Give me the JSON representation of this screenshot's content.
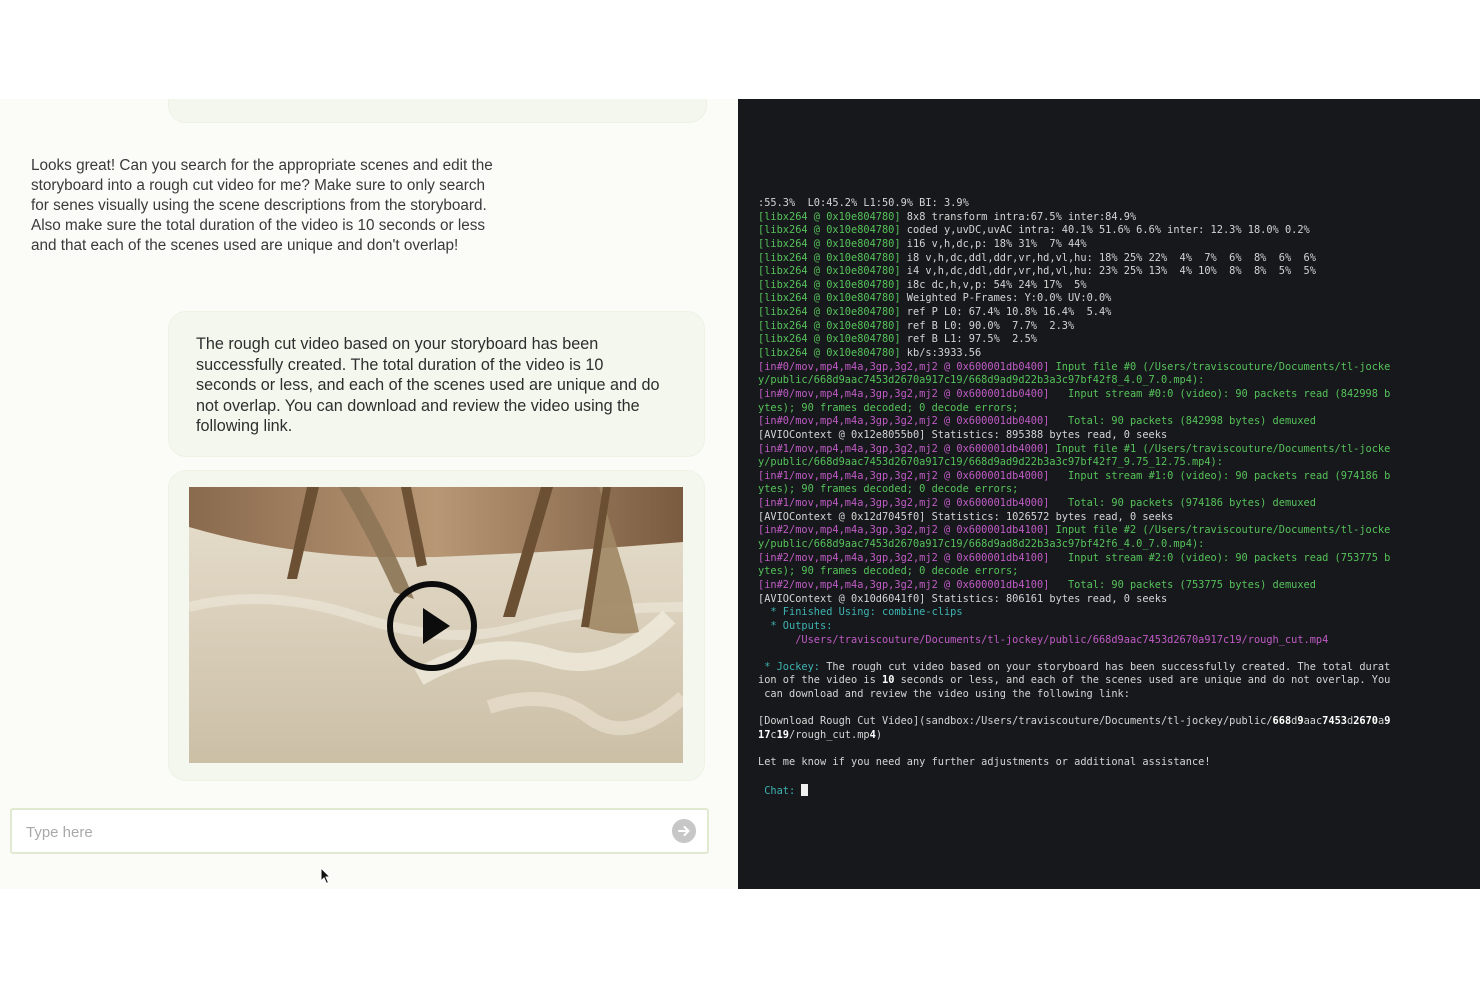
{
  "chat": {
    "user_message": "Looks great! Can you search for the appropriate scenes and edit the storyboard into a rough cut video for me? Make sure to only search for senes visually using the scene descriptions from the storyboard. Also make sure the total duration of the video is 10 seconds or less and that each of the scenes used are unique and don't overlap!",
    "assistant_message": "The rough cut video based on your storyboard has been successfully created. The total duration of the video is 10 seconds or less, and each of the scenes used are unique and do not overlap. You can download and review the video using the following link.",
    "input_placeholder": "Type here",
    "send_icon": "arrow-right-circle-icon",
    "play_icon": "play-circle-icon"
  },
  "terminal": {
    "lines": [
      [
        {
          "t": ":55.3%  L0:45.2% L1:50.9% BI: 3.9%",
          "c": "w"
        }
      ],
      [
        {
          "t": "[libx264 @ 0x10e804780]",
          "c": "g"
        },
        {
          "t": " 8x8 transform intra:67.5% inter:84.9%",
          "c": "w"
        }
      ],
      [
        {
          "t": "[libx264 @ 0x10e804780]",
          "c": "g"
        },
        {
          "t": " coded y,uvDC,uvAC intra: 40.1% 51.6% 6.6% inter: 12.3% 18.0% 0.2%",
          "c": "w"
        }
      ],
      [
        {
          "t": "[libx264 @ 0x10e804780]",
          "c": "g"
        },
        {
          "t": " i16 v,h,dc,p: 18% 31%  7% 44%",
          "c": "w"
        }
      ],
      [
        {
          "t": "[libx264 @ 0x10e804780]",
          "c": "g"
        },
        {
          "t": " i8 v,h,dc,ddl,ddr,vr,hd,vl,hu: 18% 25% 22%  4%  7%  6%  8%  6%  6%",
          "c": "w"
        }
      ],
      [
        {
          "t": "[libx264 @ 0x10e804780]",
          "c": "g"
        },
        {
          "t": " i4 v,h,dc,ddl,ddr,vr,hd,vl,hu: 23% 25% 13%  4% 10%  8%  8%  5%  5%",
          "c": "w"
        }
      ],
      [
        {
          "t": "[libx264 @ 0x10e804780]",
          "c": "g"
        },
        {
          "t": " i8c dc,h,v,p: 54% 24% 17%  5%",
          "c": "w"
        }
      ],
      [
        {
          "t": "[libx264 @ 0x10e804780]",
          "c": "g"
        },
        {
          "t": " Weighted P-Frames: Y:0.0% UV:0.0%",
          "c": "w"
        }
      ],
      [
        {
          "t": "[libx264 @ 0x10e804780]",
          "c": "g"
        },
        {
          "t": " ref P L0: 67.4% 10.8% 16.4%  5.4%",
          "c": "w"
        }
      ],
      [
        {
          "t": "[libx264 @ 0x10e804780]",
          "c": "g"
        },
        {
          "t": " ref B L0: 90.0%  7.7%  2.3%",
          "c": "w"
        }
      ],
      [
        {
          "t": "[libx264 @ 0x10e804780]",
          "c": "g"
        },
        {
          "t": " ref B L1: 97.5%  2.5%",
          "c": "w"
        }
      ],
      [
        {
          "t": "[libx264 @ 0x10e804780]",
          "c": "g"
        },
        {
          "t": " kb/s:3933.56",
          "c": "w"
        }
      ],
      [
        {
          "t": "[in#0/mov,mp4,m4a,3gp,3g2,mj2 @ 0x600001db0400]",
          "c": "m"
        },
        {
          "t": " Input file #0 (/Users/traviscouture/Documents/tl-jocke",
          "c": "g"
        }
      ],
      [
        {
          "t": "y/public/668d9aac7453d2670a917c19/668d9ad9d22b3a3c97bf42f8_4.0_7.0.mp4):",
          "c": "g"
        }
      ],
      [
        {
          "t": "[in#0/mov,mp4,m4a,3gp,3g2,mj2 @ 0x600001db0400]",
          "c": "m"
        },
        {
          "t": "   Input stream #0:0 (video): 90 packets read (842998 b",
          "c": "g"
        }
      ],
      [
        {
          "t": "ytes); 90 frames decoded; 0 decode errors;",
          "c": "g"
        }
      ],
      [
        {
          "t": "[in#0/mov,mp4,m4a,3gp,3g2,mj2 @ 0x600001db0400]",
          "c": "m"
        },
        {
          "t": "   Total: 90 packets (842998 bytes) demuxed",
          "c": "g"
        }
      ],
      [
        {
          "t": "[AVIOContext @ 0x12e8055b0] Statistics: 895388 bytes read, 0 seeks",
          "c": "w"
        }
      ],
      [
        {
          "t": "[in#1/mov,mp4,m4a,3gp,3g2,mj2 @ 0x600001db4000]",
          "c": "m"
        },
        {
          "t": " Input file #1 (/Users/traviscouture/Documents/tl-jocke",
          "c": "g"
        }
      ],
      [
        {
          "t": "y/public/668d9aac7453d2670a917c19/668d9ad9d22b3a3c97bf42f7_9.75_12.75.mp4):",
          "c": "g"
        }
      ],
      [
        {
          "t": "[in#1/mov,mp4,m4a,3gp,3g2,mj2 @ 0x600001db4000]",
          "c": "m"
        },
        {
          "t": "   Input stream #1:0 (video): 90 packets read (974186 b",
          "c": "g"
        }
      ],
      [
        {
          "t": "ytes); 90 frames decoded; 0 decode errors;",
          "c": "g"
        }
      ],
      [
        {
          "t": "[in#1/mov,mp4,m4a,3gp,3g2,mj2 @ 0x600001db4000]",
          "c": "m"
        },
        {
          "t": "   Total: 90 packets (974186 bytes) demuxed",
          "c": "g"
        }
      ],
      [
        {
          "t": "[AVIOContext @ 0x12d7045f0] Statistics: 1026572 bytes read, 0 seeks",
          "c": "w"
        }
      ],
      [
        {
          "t": "[in#2/mov,mp4,m4a,3gp,3g2,mj2 @ 0x600001db4100]",
          "c": "m"
        },
        {
          "t": " Input file #2 (/Users/traviscouture/Documents/tl-jocke",
          "c": "g"
        }
      ],
      [
        {
          "t": "y/public/668d9aac7453d2670a917c19/668d9ad8d22b3a3c97bf42f6_4.0_7.0.mp4):",
          "c": "g"
        }
      ],
      [
        {
          "t": "[in#2/mov,mp4,m4a,3gp,3g2,mj2 @ 0x600001db4100]",
          "c": "m"
        },
        {
          "t": "   Input stream #2:0 (video): 90 packets read (753775 b",
          "c": "g"
        }
      ],
      [
        {
          "t": "ytes); 90 frames decoded; 0 decode errors;",
          "c": "g"
        }
      ],
      [
        {
          "t": "[in#2/mov,mp4,m4a,3gp,3g2,mj2 @ 0x600001db4100]",
          "c": "m"
        },
        {
          "t": "   Total: 90 packets (753775 bytes) demuxed",
          "c": "g"
        }
      ],
      [
        {
          "t": "[AVIOContext @ 0x10d6041f0] Statistics: 806161 bytes read, 0 seeks",
          "c": "w"
        }
      ],
      [
        {
          "t": "  * Finished Using: combine-clips",
          "c": "c"
        }
      ],
      [
        {
          "t": "  * Outputs:",
          "c": "c"
        }
      ],
      [
        {
          "t": "      /Users/traviscouture/Documents/tl-jockey/public/668d9aac7453d2670a917c19/rough_cut.mp4",
          "c": "m"
        }
      ],
      [
        {
          "t": "",
          "c": "w"
        }
      ],
      [
        {
          "t": " * Jockey:",
          "c": "c"
        },
        {
          "t": " The rough cut video based on your storyboard has been successfully created. The total durat",
          "c": "w"
        }
      ],
      [
        {
          "t": "ion of the video is ",
          "c": "w"
        },
        {
          "t": "10",
          "c": "b"
        },
        {
          "t": " seconds or less, and each of the scenes used are unique and do not overlap. You",
          "c": "w"
        }
      ],
      [
        {
          "t": " can download and review the video using the following link:",
          "c": "w"
        }
      ],
      [
        {
          "t": "",
          "c": "w"
        }
      ],
      [
        {
          "t": "[Download Rough Cut Video](sandbox:/Users/traviscouture/Documents/tl-jockey/public/",
          "c": "w"
        },
        {
          "t": "668",
          "c": "b"
        },
        {
          "t": "d",
          "c": "w"
        },
        {
          "t": "9",
          "c": "b"
        },
        {
          "t": "aac",
          "c": "w"
        },
        {
          "t": "7453",
          "c": "b"
        },
        {
          "t": "d",
          "c": "w"
        },
        {
          "t": "2670",
          "c": "b"
        },
        {
          "t": "a",
          "c": "w"
        },
        {
          "t": "9",
          "c": "b"
        }
      ],
      [
        {
          "t": "17",
          "c": "b"
        },
        {
          "t": "c",
          "c": "w"
        },
        {
          "t": "19",
          "c": "b"
        },
        {
          "t": "/rough_cut.mp",
          "c": "w"
        },
        {
          "t": "4",
          "c": "b"
        },
        {
          "t": ")",
          "c": "w"
        }
      ],
      [
        {
          "t": "",
          "c": "w"
        }
      ],
      [
        {
          "t": "Let me know if you need any further adjustments or additional assistance!",
          "c": "w"
        }
      ],
      [
        {
          "t": "",
          "c": "w"
        }
      ],
      [
        {
          "t": " Chat: ",
          "c": "c"
        }
      ]
    ],
    "prompt_icon": "user-icon"
  },
  "colors": {
    "terminal_bg": "#16181b",
    "chat_bg": "#fbfcf8",
    "bubble_bg": "#f4f7ee",
    "term_green": "#56c25a",
    "term_magenta": "#c05bc6",
    "term_cyan": "#3fb3b3"
  }
}
